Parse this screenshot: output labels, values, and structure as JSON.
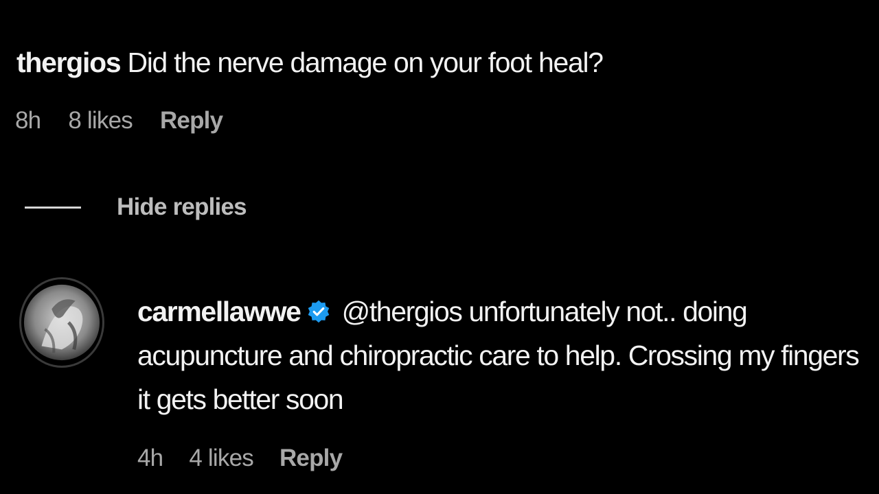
{
  "comment": {
    "username": "thergios",
    "text": "Did the nerve damage on your foot heal?",
    "time": "8h",
    "likes": "8 likes",
    "reply_label": "Reply"
  },
  "thread": {
    "hide_replies_label": "Hide replies"
  },
  "reply": {
    "username": "carmellawwe",
    "verified_icon": "verified-badge-icon",
    "mention": "@thergios",
    "text": "unfortunately not.. doing acupuncture and chiropractic care to help. Crossing my fingers it gets better soon",
    "time": "4h",
    "likes": "4 likes",
    "reply_label": "Reply"
  },
  "colors": {
    "background": "#000000",
    "text_primary": "#f2f2f2",
    "text_secondary": "#a8a8a8",
    "verified_blue": "#1d9bf0"
  }
}
